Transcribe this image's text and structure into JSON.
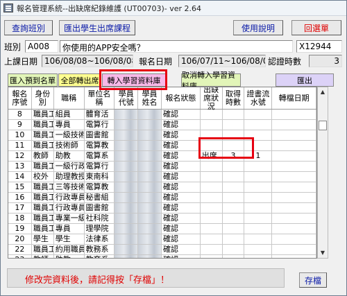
{
  "window": {
    "title": "報名管理系統--出缺席紀錄維護 (UT00703)- ver 2.64"
  },
  "toolbar": {
    "query_class": "查詢班別",
    "export_attendance": "匯出學生出席課程",
    "help": "使用說明",
    "back_menu": "回選單"
  },
  "info": {
    "class_label": "班別",
    "class_code": "A008",
    "class_name": "你使用的APP安全嗎？",
    "class_id": "X12944",
    "class_date_label": "上課日期",
    "class_date": "106/08/08~106/08/08",
    "signup_date_label": "報名日期",
    "signup_date": "106/07/11~106/08/08",
    "cert_hours_label": "認證時數",
    "cert_hours": "3"
  },
  "tabs": {
    "import_signup": "匯入預到名單",
    "all_present": "全部轉出席",
    "import_learning": "轉入學習資料庫",
    "cancel_learning": "取消轉入學習資料庫",
    "export": "匯出"
  },
  "table": {
    "headers": [
      "報名序號",
      "身份別",
      "職稱",
      "單位名稱",
      "學員代號",
      "學員姓名",
      "報名狀態",
      "出缺席狀況",
      "取得時數",
      "證書流水號",
      "轉檔日期"
    ],
    "rows": [
      {
        "seq": "8",
        "type": "職員工",
        "title": "組員",
        "unit": "體育活",
        "status": "確認",
        "attend": "",
        "hours": "",
        "cert": ""
      },
      {
        "seq": "9",
        "type": "職員工",
        "title": "專員",
        "unit": "電算行",
        "status": "確認",
        "attend": "",
        "hours": "",
        "cert": ""
      },
      {
        "seq": "10",
        "type": "職員工",
        "title": "一級技術",
        "unit": "圖書館",
        "status": "確認",
        "attend": "",
        "hours": "",
        "cert": ""
      },
      {
        "seq": "11",
        "type": "職員工",
        "title": "技術師",
        "unit": "電算教",
        "status": "確認",
        "attend": "",
        "hours": "",
        "cert": ""
      },
      {
        "seq": "12",
        "type": "教師",
        "title": "助教",
        "unit": "電算系",
        "status": "確認",
        "attend": "出席",
        "hours": "3",
        "cert": "1"
      },
      {
        "seq": "13",
        "type": "職員工",
        "title": "一級行政",
        "unit": "電算行",
        "status": "確認",
        "attend": "",
        "hours": "",
        "cert": ""
      },
      {
        "seq": "14",
        "type": "校外",
        "title": "助理教授",
        "unit": "東南科",
        "status": "確認",
        "attend": "",
        "hours": "",
        "cert": ""
      },
      {
        "seq": "15",
        "type": "職員工",
        "title": "三等技術",
        "unit": "電算教",
        "status": "確認",
        "attend": "",
        "hours": "",
        "cert": ""
      },
      {
        "seq": "16",
        "type": "職員工",
        "title": "行政專員",
        "unit": "秘書組",
        "status": "確認",
        "attend": "",
        "hours": "",
        "cert": ""
      },
      {
        "seq": "17",
        "type": "職員工",
        "title": "行政專員",
        "unit": "圖書館",
        "status": "確認",
        "attend": "",
        "hours": "",
        "cert": ""
      },
      {
        "seq": "18",
        "type": "職員工",
        "title": "專業一級",
        "unit": "社科院",
        "status": "確認",
        "attend": "",
        "hours": "",
        "cert": ""
      },
      {
        "seq": "19",
        "type": "職員工",
        "title": "專員",
        "unit": "理學院",
        "status": "確認",
        "attend": "",
        "hours": "",
        "cert": ""
      },
      {
        "seq": "20",
        "type": "學生",
        "title": "學生",
        "unit": "法律系",
        "status": "確認",
        "attend": "",
        "hours": "",
        "cert": ""
      },
      {
        "seq": "22",
        "type": "職員工",
        "title": "約用職員",
        "unit": "教務系",
        "status": "確認",
        "attend": "",
        "hours": "",
        "cert": ""
      },
      {
        "seq": "23",
        "type": "教師",
        "title": "助教",
        "unit": "教育系",
        "status": "確認",
        "attend": "",
        "hours": "",
        "cert": ""
      },
      {
        "seq": "24",
        "type": "職員工",
        "title": "四等技術",
        "unit": "電算網",
        "status": "確認",
        "attend": "",
        "hours": "",
        "cert": ""
      },
      {
        "seq": "25",
        "type": "職員工",
        "title": "約用職員",
        "unit": "總務處",
        "status": "確認",
        "attend": "",
        "hours": "",
        "cert": ""
      }
    ]
  },
  "status": {
    "message": "修改完資料後，請記得按「存檔」！",
    "save": "存檔"
  },
  "colors": {
    "highlight_red": "#e60012",
    "label_blue": "#0a1aa8",
    "warn_red": "#e00000"
  }
}
